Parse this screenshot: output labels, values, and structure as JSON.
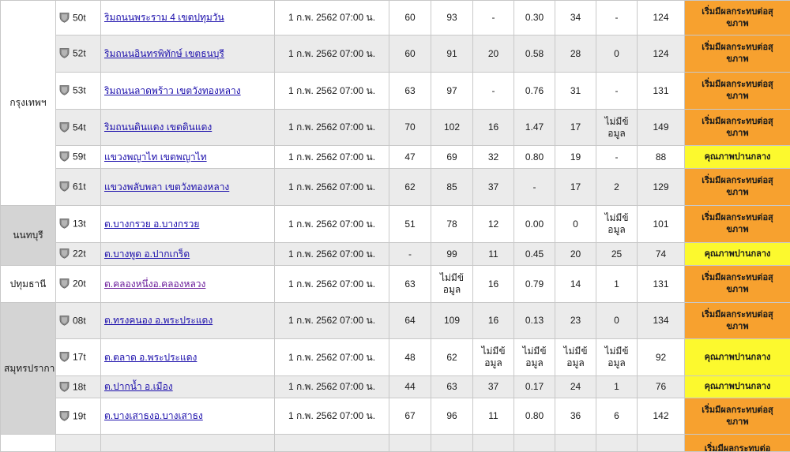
{
  "provinces": [
    {
      "name": "กรุงเทพฯ",
      "rows": 6,
      "bg": "white"
    },
    {
      "name": "นนทบุรี",
      "rows": 2,
      "bg": "gray"
    },
    {
      "name": "ปทุมธานี",
      "rows": 1,
      "bg": "white"
    },
    {
      "name": "สมุทรปราการ",
      "rows": 4,
      "bg": "gray"
    },
    {
      "name": "",
      "rows": 1,
      "bg": "white"
    }
  ],
  "rows": [
    {
      "code": "50t",
      "location": "ริมถนนพระราม 4 เขตปทุมวัน",
      "datetime": "1 ก.พ. 2562 07:00 น.",
      "values": [
        "60",
        "93",
        "-",
        "0.30",
        "34",
        "-",
        "124"
      ],
      "level": "เริ่มมีผลกระทบต่อสุขภาพ",
      "level_type": "orange",
      "bg": "white",
      "h": 44
    },
    {
      "code": "52t",
      "location": "ริมถนนอินทรพิทักษ์ เขตธนบุรี",
      "datetime": "1 ก.พ. 2562 07:00 น.",
      "values": [
        "60",
        "91",
        "20",
        "0.58",
        "28",
        "0",
        "124"
      ],
      "level": "เริ่มมีผลกระทบต่อสุขภาพ",
      "level_type": "orange",
      "bg": "gray",
      "h": 47
    },
    {
      "code": "53t",
      "location": "ริมถนนลาดพร้าว เขตวังทองหลาง",
      "datetime": "1 ก.พ. 2562 07:00 น.",
      "values": [
        "63",
        "97",
        "-",
        "0.76",
        "31",
        "-",
        "131"
      ],
      "level": "เริ่มมีผลกระทบต่อสุขภาพ",
      "level_type": "orange",
      "bg": "white",
      "h": 47
    },
    {
      "code": "54t",
      "location": "ริมถนนดินแดง เขตดินแดง",
      "datetime": "1 ก.พ. 2562 07:00 น.",
      "values": [
        "70",
        "102",
        "16",
        "1.47",
        "17",
        "ไม่มีข้อมูล",
        "149"
      ],
      "level": "เริ่มมีผลกระทบต่อสุขภาพ",
      "level_type": "orange",
      "bg": "gray",
      "h": 46
    },
    {
      "code": "59t",
      "location": "แขวงพญาไท เขตพญาไท",
      "datetime": "1 ก.พ. 2562 07:00 น.",
      "values": [
        "47",
        "69",
        "32",
        "0.80",
        "19",
        "-",
        "88"
      ],
      "level": "คุณภาพปานกลาง",
      "level_type": "yellow",
      "bg": "white",
      "h": 29
    },
    {
      "code": "61t",
      "location": "แขวงพลับพลา เขตวังทองหลาง",
      "datetime": "1 ก.พ. 2562 07:00 น.",
      "values": [
        "62",
        "85",
        "37",
        "-",
        "17",
        "2",
        "129"
      ],
      "level": "เริ่มมีผลกระทบต่อสุขภาพ",
      "level_type": "orange",
      "bg": "gray",
      "h": 47
    },
    {
      "code": "13t",
      "location": "ต.บางกรวย อ.บางกรวย",
      "datetime": "1 ก.พ. 2562 07:00 น.",
      "values": [
        "51",
        "78",
        "12",
        "0.00",
        "0",
        "ไม่มีข้อมูล",
        "101"
      ],
      "level": "เริ่มมีผลกระทบต่อสุขภาพ",
      "level_type": "orange",
      "bg": "white",
      "h": 47
    },
    {
      "code": "22t",
      "location": "ต.บางพูด อ.ปากเกร็ด",
      "datetime": "1 ก.พ. 2562 07:00 น.",
      "values": [
        "-",
        "99",
        "11",
        "0.45",
        "20",
        "25",
        "74"
      ],
      "level": "คุณภาพปานกลาง",
      "level_type": "yellow",
      "bg": "gray",
      "h": 29
    },
    {
      "code": "20t",
      "location": "ต.คลองหนึ่งอ.คลองหลวง",
      "datetime": "1 ก.พ. 2562 07:00 น.",
      "values": [
        "63",
        "ไม่มีข้อมูล",
        "16",
        "0.79",
        "14",
        "1",
        "131"
      ],
      "level": "เริ่มมีผลกระทบต่อสุขภาพ",
      "level_type": "orange",
      "bg": "white",
      "h": 47,
      "visited": true
    },
    {
      "code": "08t",
      "location": "ต.ทรงคนอง อ.พระประแดง",
      "datetime": "1 ก.พ. 2562 07:00 น.",
      "values": [
        "64",
        "109",
        "16",
        "0.13",
        "23",
        "0",
        "134"
      ],
      "level": "เริ่มมีผลกระทบต่อสุขภาพ",
      "level_type": "orange",
      "bg": "gray",
      "h": 46
    },
    {
      "code": "17t",
      "location": "ต.ตลาด อ.พระประแดง",
      "datetime": "1 ก.พ. 2562 07:00 น.",
      "values": [
        "48",
        "62",
        "ไม่มีข้อมูล",
        "ไม่มีข้อมูล",
        "ไม่มีข้อมูล",
        "ไม่มีข้อมูล",
        "92"
      ],
      "level": "คุณภาพปานกลาง",
      "level_type": "yellow",
      "bg": "white",
      "h": 47
    },
    {
      "code": "18t",
      "location": "ต.ปากน้ำ อ.เมือง",
      "datetime": "1 ก.พ. 2562 07:00 น.",
      "values": [
        "44",
        "63",
        "37",
        "0.17",
        "24",
        "1",
        "76"
      ],
      "level": "คุณภาพปานกลาง",
      "level_type": "yellow",
      "bg": "gray",
      "h": 28
    },
    {
      "code": "19t",
      "location": "ต.บางเสาธงอ.บางเสาธง",
      "datetime": "1 ก.พ. 2562 07:00 น.",
      "values": [
        "67",
        "96",
        "11",
        "0.80",
        "36",
        "6",
        "142"
      ],
      "level": "เริ่มมีผลกระทบต่อสุขภาพ",
      "level_type": "orange",
      "bg": "white",
      "h": 46
    },
    {
      "code": "",
      "location": "",
      "datetime": "",
      "values": [
        "",
        "",
        "",
        "",
        "",
        "",
        ""
      ],
      "level": "เริ่มมีผลกระทบต่อ",
      "level_type": "orange",
      "bg": "gray",
      "h": 22
    }
  ]
}
